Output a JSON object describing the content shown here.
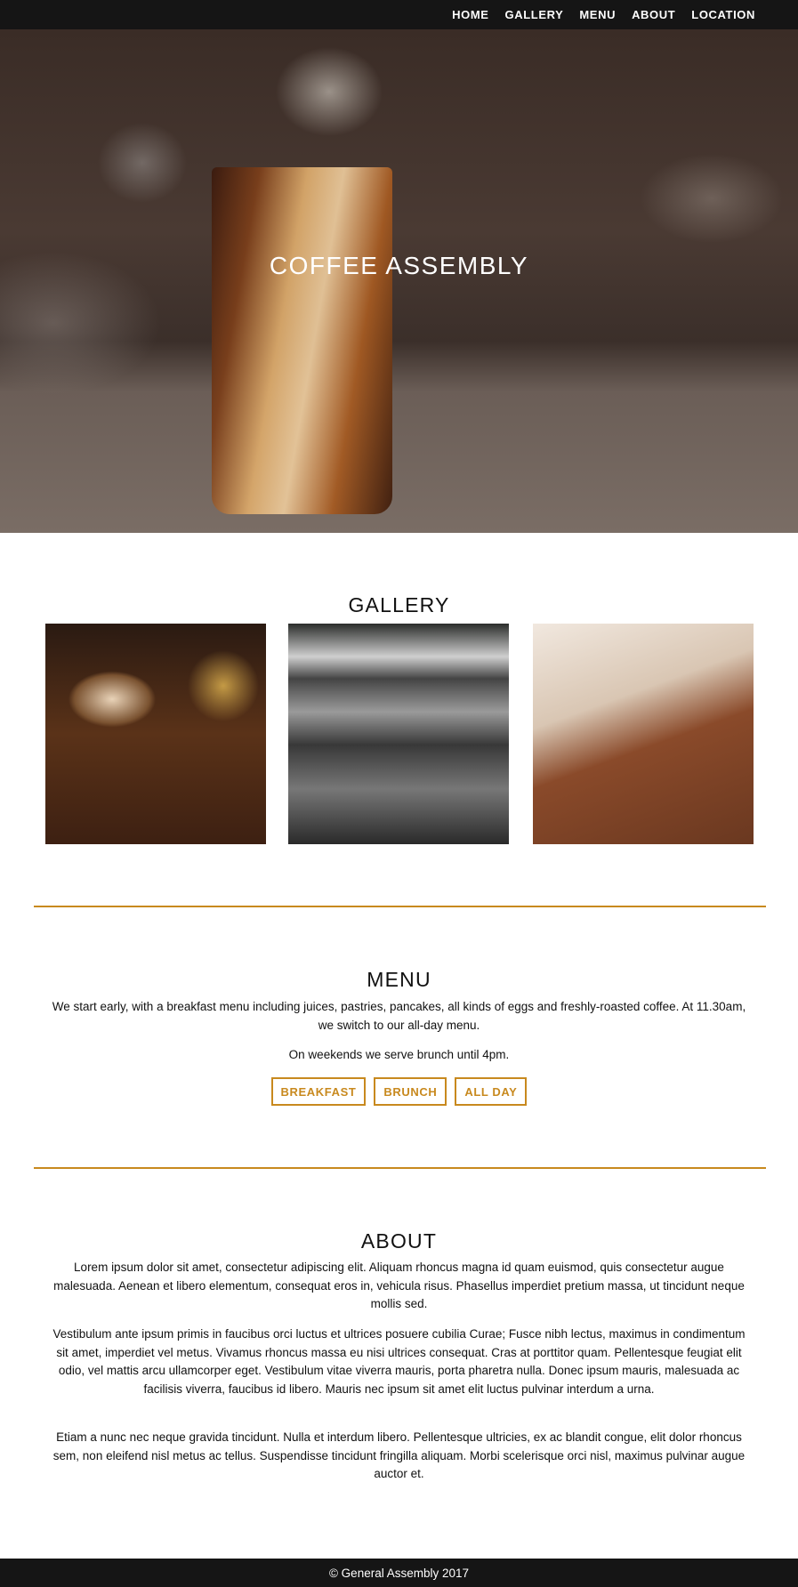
{
  "nav": {
    "items": [
      "HOME",
      "GALLERY",
      "MENU",
      "ABOUT",
      "LOCATION"
    ]
  },
  "hero": {
    "title": "COFFEE ASSEMBLY"
  },
  "gallery": {
    "heading": "GALLERY"
  },
  "menu": {
    "heading": "MENU",
    "text1": "We start early, with a breakfast menu including juices, pastries, pancakes, all kinds of eggs and freshly-roasted coffee. At 11.30am, we switch to our all-day menu.",
    "text2": "On weekends we serve brunch until 4pm.",
    "buttons": [
      "BREAKFAST",
      "BRUNCH",
      "ALL DAY"
    ]
  },
  "about": {
    "heading": "ABOUT",
    "paragraphs": [
      "Lorem ipsum dolor sit amet, consectetur adipiscing elit. Aliquam rhoncus magna id quam euismod, quis consectetur augue malesuada. Aenean et libero elementum, consequat eros in, vehicula risus. Phasellus imperdiet pretium massa, ut tincidunt neque mollis sed.",
      "Vestibulum ante ipsum primis in faucibus orci luctus et ultrices posuere cubilia Curae; Fusce nibh lectus, maximus in condimentum sit amet, imperdiet vel metus. Vivamus rhoncus massa eu nisi ultrices consequat. Cras at porttitor quam. Pellentesque feugiat elit odio, vel mattis arcu ullamcorper eget. Vestibulum vitae viverra mauris, porta pharetra nulla. Donec ipsum mauris, malesuada ac facilisis viverra, faucibus id libero. Mauris nec ipsum sit amet elit luctus pulvinar interdum a urna.",
      "Etiam a nunc nec neque gravida tincidunt. Nulla et interdum libero. Pellentesque ultricies, ex ac blandit congue, elit dolor rhoncus sem, non eleifend nisl metus ac tellus. Suspendisse tincidunt fringilla aliquam. Morbi scelerisque orci nisl, maximus pulvinar augue auctor et."
    ]
  },
  "footer": {
    "text": "© General Assembly 2017"
  },
  "colors": {
    "accent": "#c8891e",
    "nav_bg": "#151515"
  }
}
